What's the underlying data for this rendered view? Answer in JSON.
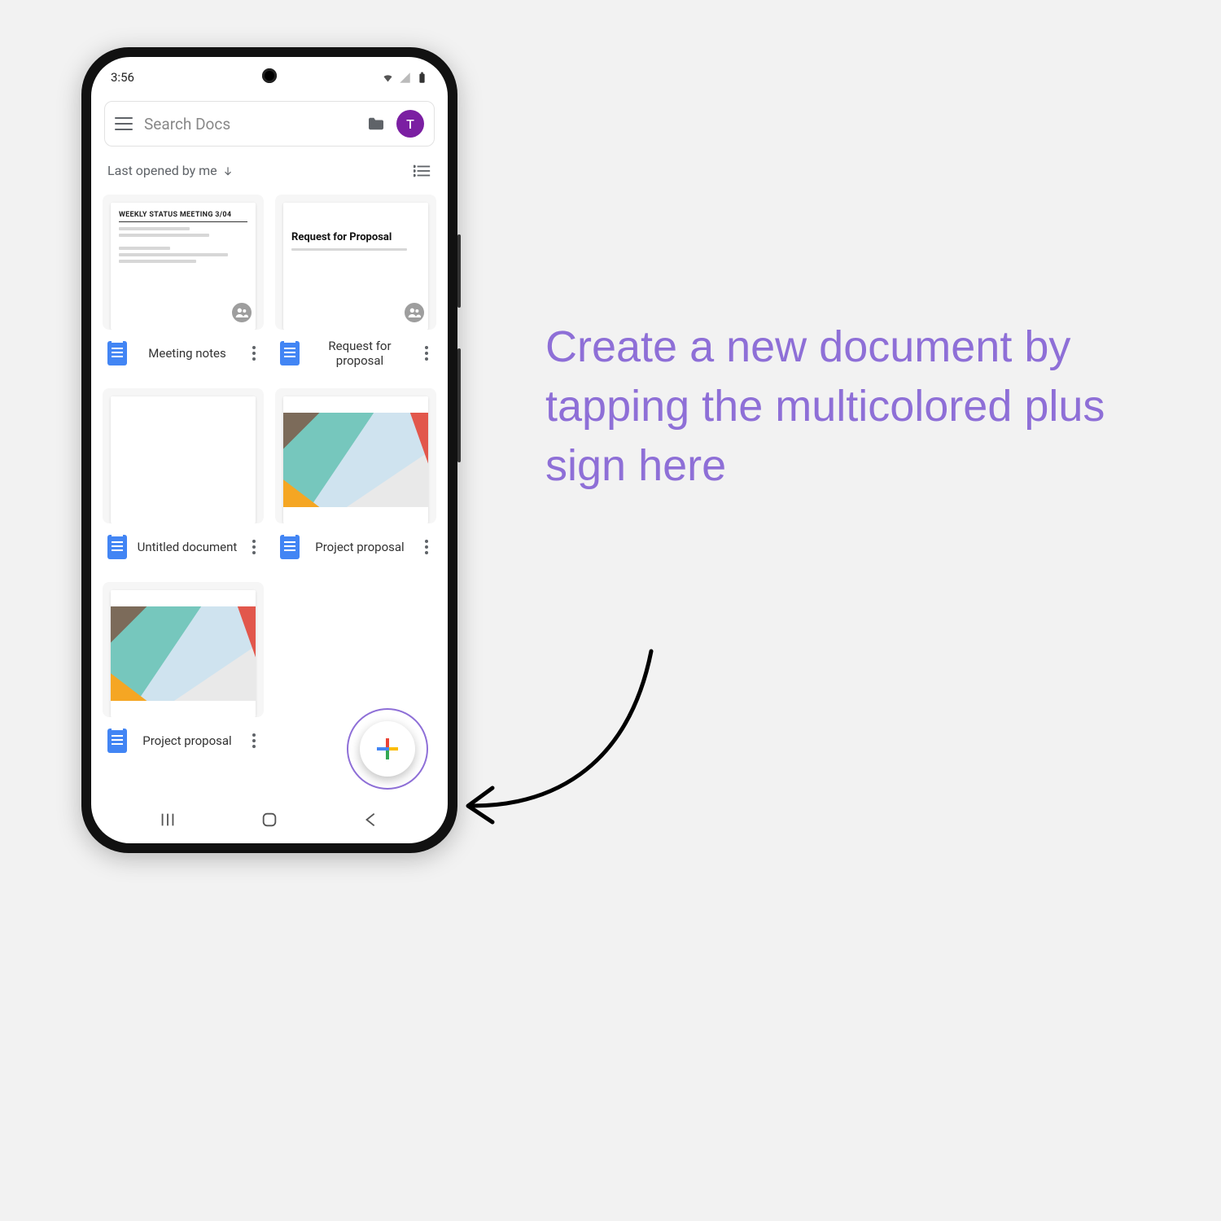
{
  "statusbar": {
    "time": "3:56"
  },
  "search": {
    "placeholder": "Search Docs",
    "avatar_initial": "T"
  },
  "sort": {
    "label": "Last opened by me"
  },
  "docs": [
    {
      "title": "Meeting notes",
      "thumb_hdr": "WEEKLY STATUS MEETING 3/04",
      "shared": true,
      "style": "text"
    },
    {
      "title": "Request for proposal",
      "thumb_hdr": "Request for Proposal",
      "shared": true,
      "style": "rfp"
    },
    {
      "title": "Untitled document",
      "thumb_hdr": "",
      "shared": false,
      "style": "blank"
    },
    {
      "title": "Project proposal",
      "thumb_hdr": "",
      "shared": false,
      "style": "image"
    },
    {
      "title": "Project proposal",
      "thumb_hdr": "",
      "shared": false,
      "style": "image"
    }
  ],
  "callout": {
    "text": "Create a new document by tapping the multicolored plus sign here"
  }
}
